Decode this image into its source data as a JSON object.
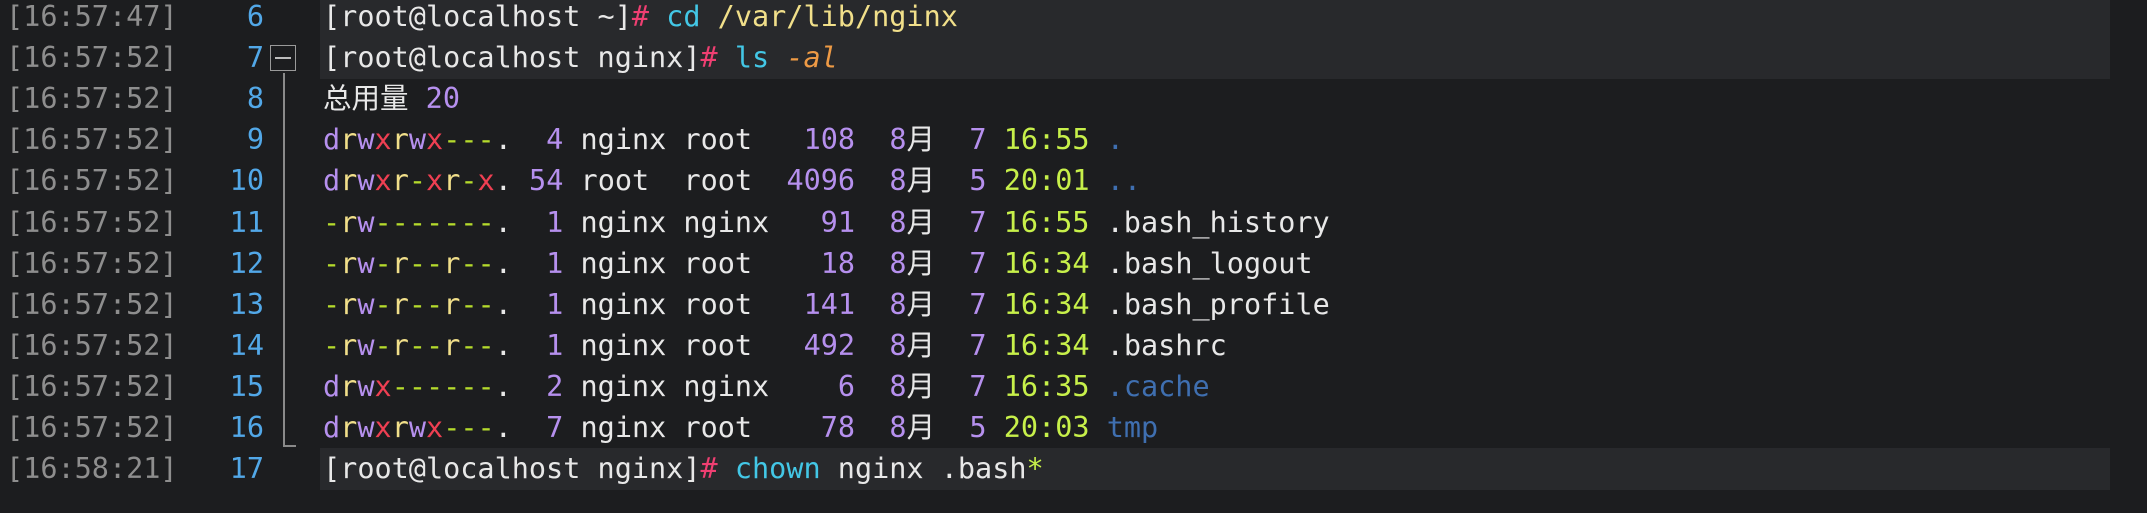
{
  "terminal": {
    "lines": [
      {
        "ts": "[16:57:47]",
        "ln": "6",
        "segments": [
          {
            "t": "[root@localhost ~]",
            "c": "c-def"
          },
          {
            "t": "# ",
            "c": "c-pink"
          },
          {
            "t": "cd ",
            "c": "c-cyan"
          },
          {
            "t": "/var/lib/nginx",
            "c": "c-yellow"
          }
        ]
      },
      {
        "ts": "[16:57:52]",
        "ln": "7",
        "segments": [
          {
            "t": "[root@localhost nginx]",
            "c": "c-def"
          },
          {
            "t": "# ",
            "c": "c-pink"
          },
          {
            "t": "ls ",
            "c": "c-cyan"
          },
          {
            "t": "-al",
            "c": "c-orange"
          }
        ]
      },
      {
        "ts": "[16:57:52]",
        "ln": "8",
        "segments": [
          {
            "t": "总用量 ",
            "c": "c-def"
          },
          {
            "t": "20",
            "c": "c-purple"
          }
        ]
      },
      {
        "ts": "[16:57:52]",
        "ln": "9",
        "segments": [
          {
            "t": "d",
            "c": "c-purple"
          },
          {
            "t": "r",
            "c": "c-yellow"
          },
          {
            "t": "w",
            "c": "c-purple"
          },
          {
            "t": "x",
            "c": "c-red"
          },
          {
            "t": "r",
            "c": "c-yellow"
          },
          {
            "t": "w",
            "c": "c-purple"
          },
          {
            "t": "x",
            "c": "c-red"
          },
          {
            "t": "---",
            "c": "c-green"
          },
          {
            "t": ".  ",
            "c": "c-def"
          },
          {
            "t": "4",
            "c": "c-purple"
          },
          {
            "t": " nginx root   ",
            "c": "c-def"
          },
          {
            "t": "108",
            "c": "c-purple"
          },
          {
            "t": "  ",
            "c": "c-def"
          },
          {
            "t": "8",
            "c": "c-purple"
          },
          {
            "t": "月  ",
            "c": "c-def"
          },
          {
            "t": "7",
            "c": "c-purple"
          },
          {
            "t": " ",
            "c": "c-def"
          },
          {
            "t": "16:55",
            "c": "c-lime"
          },
          {
            "t": " ",
            "c": "c-def"
          },
          {
            "t": ".",
            "c": "c-blue"
          }
        ]
      },
      {
        "ts": "[16:57:52]",
        "ln": "10",
        "segments": [
          {
            "t": "d",
            "c": "c-purple"
          },
          {
            "t": "r",
            "c": "c-yellow"
          },
          {
            "t": "w",
            "c": "c-purple"
          },
          {
            "t": "x",
            "c": "c-red"
          },
          {
            "t": "r",
            "c": "c-yellow"
          },
          {
            "t": "-",
            "c": "c-green"
          },
          {
            "t": "x",
            "c": "c-red"
          },
          {
            "t": "r",
            "c": "c-yellow"
          },
          {
            "t": "-",
            "c": "c-green"
          },
          {
            "t": "x",
            "c": "c-red"
          },
          {
            "t": ". ",
            "c": "c-def"
          },
          {
            "t": "54",
            "c": "c-purple"
          },
          {
            "t": " root  root  ",
            "c": "c-def"
          },
          {
            "t": "4096",
            "c": "c-purple"
          },
          {
            "t": "  ",
            "c": "c-def"
          },
          {
            "t": "8",
            "c": "c-purple"
          },
          {
            "t": "月  ",
            "c": "c-def"
          },
          {
            "t": "5",
            "c": "c-purple"
          },
          {
            "t": " ",
            "c": "c-def"
          },
          {
            "t": "20:01",
            "c": "c-lime"
          },
          {
            "t": " ",
            "c": "c-def"
          },
          {
            "t": "..",
            "c": "c-blue"
          }
        ]
      },
      {
        "ts": "[16:57:52]",
        "ln": "11",
        "segments": [
          {
            "t": "-",
            "c": "c-green"
          },
          {
            "t": "r",
            "c": "c-yellow"
          },
          {
            "t": "w",
            "c": "c-purple"
          },
          {
            "t": "-------",
            "c": "c-green"
          },
          {
            "t": ".  ",
            "c": "c-def"
          },
          {
            "t": "1",
            "c": "c-purple"
          },
          {
            "t": " nginx nginx   ",
            "c": "c-def"
          },
          {
            "t": "91",
            "c": "c-purple"
          },
          {
            "t": "  ",
            "c": "c-def"
          },
          {
            "t": "8",
            "c": "c-purple"
          },
          {
            "t": "月  ",
            "c": "c-def"
          },
          {
            "t": "7",
            "c": "c-purple"
          },
          {
            "t": " ",
            "c": "c-def"
          },
          {
            "t": "16:55",
            "c": "c-lime"
          },
          {
            "t": " .bash_history",
            "c": "c-def"
          }
        ]
      },
      {
        "ts": "[16:57:52]",
        "ln": "12",
        "segments": [
          {
            "t": "-",
            "c": "c-green"
          },
          {
            "t": "r",
            "c": "c-yellow"
          },
          {
            "t": "w",
            "c": "c-purple"
          },
          {
            "t": "-",
            "c": "c-green"
          },
          {
            "t": "r",
            "c": "c-yellow"
          },
          {
            "t": "--",
            "c": "c-green"
          },
          {
            "t": "r",
            "c": "c-yellow"
          },
          {
            "t": "--",
            "c": "c-green"
          },
          {
            "t": ".  ",
            "c": "c-def"
          },
          {
            "t": "1",
            "c": "c-purple"
          },
          {
            "t": " nginx root    ",
            "c": "c-def"
          },
          {
            "t": "18",
            "c": "c-purple"
          },
          {
            "t": "  ",
            "c": "c-def"
          },
          {
            "t": "8",
            "c": "c-purple"
          },
          {
            "t": "月  ",
            "c": "c-def"
          },
          {
            "t": "7",
            "c": "c-purple"
          },
          {
            "t": " ",
            "c": "c-def"
          },
          {
            "t": "16:34",
            "c": "c-lime"
          },
          {
            "t": " .bash_logout",
            "c": "c-def"
          }
        ]
      },
      {
        "ts": "[16:57:52]",
        "ln": "13",
        "segments": [
          {
            "t": "-",
            "c": "c-green"
          },
          {
            "t": "r",
            "c": "c-yellow"
          },
          {
            "t": "w",
            "c": "c-purple"
          },
          {
            "t": "-",
            "c": "c-green"
          },
          {
            "t": "r",
            "c": "c-yellow"
          },
          {
            "t": "--",
            "c": "c-green"
          },
          {
            "t": "r",
            "c": "c-yellow"
          },
          {
            "t": "--",
            "c": "c-green"
          },
          {
            "t": ".  ",
            "c": "c-def"
          },
          {
            "t": "1",
            "c": "c-purple"
          },
          {
            "t": " nginx root   ",
            "c": "c-def"
          },
          {
            "t": "141",
            "c": "c-purple"
          },
          {
            "t": "  ",
            "c": "c-def"
          },
          {
            "t": "8",
            "c": "c-purple"
          },
          {
            "t": "月  ",
            "c": "c-def"
          },
          {
            "t": "7",
            "c": "c-purple"
          },
          {
            "t": " ",
            "c": "c-def"
          },
          {
            "t": "16:34",
            "c": "c-lime"
          },
          {
            "t": " .bash_profile",
            "c": "c-def"
          }
        ]
      },
      {
        "ts": "[16:57:52]",
        "ln": "14",
        "segments": [
          {
            "t": "-",
            "c": "c-green"
          },
          {
            "t": "r",
            "c": "c-yellow"
          },
          {
            "t": "w",
            "c": "c-purple"
          },
          {
            "t": "-",
            "c": "c-green"
          },
          {
            "t": "r",
            "c": "c-yellow"
          },
          {
            "t": "--",
            "c": "c-green"
          },
          {
            "t": "r",
            "c": "c-yellow"
          },
          {
            "t": "--",
            "c": "c-green"
          },
          {
            "t": ".  ",
            "c": "c-def"
          },
          {
            "t": "1",
            "c": "c-purple"
          },
          {
            "t": " nginx root   ",
            "c": "c-def"
          },
          {
            "t": "492",
            "c": "c-purple"
          },
          {
            "t": "  ",
            "c": "c-def"
          },
          {
            "t": "8",
            "c": "c-purple"
          },
          {
            "t": "月  ",
            "c": "c-def"
          },
          {
            "t": "7",
            "c": "c-purple"
          },
          {
            "t": " ",
            "c": "c-def"
          },
          {
            "t": "16:34",
            "c": "c-lime"
          },
          {
            "t": " .bashrc",
            "c": "c-def"
          }
        ]
      },
      {
        "ts": "[16:57:52]",
        "ln": "15",
        "segments": [
          {
            "t": "d",
            "c": "c-purple"
          },
          {
            "t": "r",
            "c": "c-yellow"
          },
          {
            "t": "w",
            "c": "c-purple"
          },
          {
            "t": "x",
            "c": "c-red"
          },
          {
            "t": "------",
            "c": "c-green"
          },
          {
            "t": ".  ",
            "c": "c-def"
          },
          {
            "t": "2",
            "c": "c-purple"
          },
          {
            "t": " nginx nginx    ",
            "c": "c-def"
          },
          {
            "t": "6",
            "c": "c-purple"
          },
          {
            "t": "  ",
            "c": "c-def"
          },
          {
            "t": "8",
            "c": "c-purple"
          },
          {
            "t": "月  ",
            "c": "c-def"
          },
          {
            "t": "7",
            "c": "c-purple"
          },
          {
            "t": " ",
            "c": "c-def"
          },
          {
            "t": "16:35",
            "c": "c-lime"
          },
          {
            "t": " ",
            "c": "c-def"
          },
          {
            "t": ".cache",
            "c": "c-blue"
          }
        ]
      },
      {
        "ts": "[16:57:52]",
        "ln": "16",
        "segments": [
          {
            "t": "d",
            "c": "c-purple"
          },
          {
            "t": "r",
            "c": "c-yellow"
          },
          {
            "t": "w",
            "c": "c-purple"
          },
          {
            "t": "x",
            "c": "c-red"
          },
          {
            "t": "r",
            "c": "c-yellow"
          },
          {
            "t": "w",
            "c": "c-purple"
          },
          {
            "t": "x",
            "c": "c-red"
          },
          {
            "t": "---",
            "c": "c-green"
          },
          {
            "t": ".  ",
            "c": "c-def"
          },
          {
            "t": "7",
            "c": "c-purple"
          },
          {
            "t": " nginx root    ",
            "c": "c-def"
          },
          {
            "t": "78",
            "c": "c-purple"
          },
          {
            "t": "  ",
            "c": "c-def"
          },
          {
            "t": "8",
            "c": "c-purple"
          },
          {
            "t": "月  ",
            "c": "c-def"
          },
          {
            "t": "5",
            "c": "c-purple"
          },
          {
            "t": " ",
            "c": "c-def"
          },
          {
            "t": "20:03",
            "c": "c-lime"
          },
          {
            "t": " ",
            "c": "c-def"
          },
          {
            "t": "tmp",
            "c": "c-blue"
          }
        ]
      },
      {
        "ts": "[16:58:21]",
        "ln": "17",
        "segments": [
          {
            "t": "[root@localhost nginx]",
            "c": "c-def"
          },
          {
            "t": "# ",
            "c": "c-pink"
          },
          {
            "t": "chown ",
            "c": "c-cyan"
          },
          {
            "t": "nginx .bash",
            "c": "c-def"
          },
          {
            "t": "*",
            "c": "c-lime"
          }
        ]
      }
    ]
  },
  "colors": {
    "background": "#1c1d1f",
    "timestamp": "#8e8e8e",
    "line_number": "#52a8e8",
    "prompt_hash": "#ef3f72",
    "command": "#43c7e6",
    "path_arg": "#f1df8a",
    "flag": "#ee9a45",
    "number": "#b690ee",
    "time": "#c7f04a",
    "directory": "#3f6fb0"
  },
  "icons": {
    "fold_marker": "collapse-icon"
  }
}
